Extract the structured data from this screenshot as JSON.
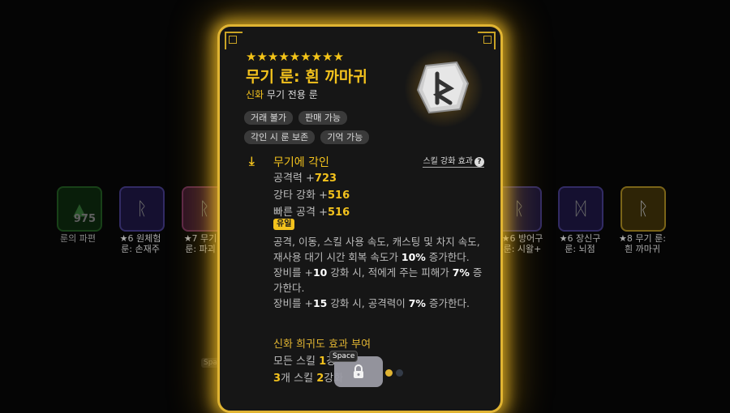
{
  "background": {
    "runes": [
      {
        "count": "975",
        "label_lines": [
          "룬의 파편"
        ],
        "star": "",
        "color": "green"
      },
      {
        "count": "",
        "label_lines": [
          "★6 원체험",
          "룬: 손재주"
        ],
        "star": "★6",
        "color": "purple"
      },
      {
        "count": "",
        "label_lines": [
          "★7 무기",
          "룬: 파괴"
        ],
        "star": "★7",
        "color": "pink"
      },
      {
        "count": "",
        "label_lines": [
          "★6 방어구",
          "룬: 시왈+"
        ],
        "star": "★6",
        "color": "purple"
      },
      {
        "count": "",
        "label_lines": [
          "★6 장신구",
          "룬: 뇌점"
        ],
        "star": "★6",
        "color": "purple"
      },
      {
        "count": "",
        "label_lines": [
          "★8 무기 룬:",
          "흰 까마귀"
        ],
        "star": "★8",
        "color": "gold"
      }
    ],
    "space_hint": "Space"
  },
  "card": {
    "stars": "★★★★★★★★★",
    "title": "무기 룬: 흰 까마귀",
    "rarity": "신화",
    "subtitle_rest": " 무기 전용 룬",
    "tags": [
      "거래 불가",
      "판매 가능",
      "각인 시 룬 보존",
      "기억 가능"
    ],
    "rune_icon": "white-raven-rune-icon",
    "section_title": "무기에 각인",
    "skill_link": "스킬 강화 효과",
    "stats": [
      {
        "label": "공격력 +",
        "value": "723"
      },
      {
        "label": "강타 강화 +",
        "value": "516"
      },
      {
        "label": "빠른 공격 +",
        "value": "516"
      }
    ],
    "unique_badge": "유일",
    "desc": {
      "p1_a": "공격, 이동, 스킬 사용 속도, 캐스팅 및 차지 속도, 재사용 대기 시간 회복 속도가 ",
      "p1_v": "10%",
      "p1_b": " 증가한다.",
      "p2_a": "장비를 +",
      "p2_v1": "10",
      "p2_b": " 강화 시, 적에게 주는 피해가 ",
      "p2_v2": "7%",
      "p2_c": " 증가한다.",
      "p3_a": "장비를 +",
      "p3_v1": "15",
      "p3_b": " 강화 시, 공격력이 ",
      "p3_v2": "7%",
      "p3_c": " 증가한다."
    },
    "rarity_effect_title": "신화 희귀도 효과 부여",
    "rarity_line1_a": "모든 스킬 ",
    "rarity_line1_v": "1",
    "rarity_line1_b": "강",
    "rarity_line2_v1": "3",
    "rarity_line2_a": "개 스킬 ",
    "rarity_line2_v2": "2",
    "rarity_line2_b": "강화"
  },
  "controls": {
    "space_key": "Space",
    "lock_icon": "lock-icon",
    "page_dots": 2,
    "active_dot": 0
  },
  "colors": {
    "gold": "#f3c21d",
    "border": "#e0b432"
  }
}
